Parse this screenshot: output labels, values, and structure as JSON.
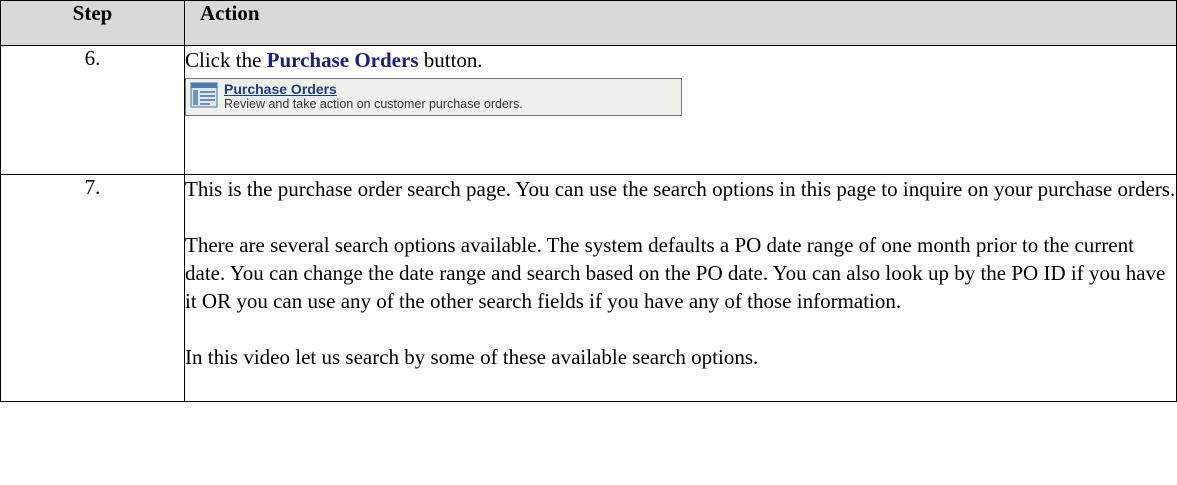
{
  "table": {
    "header": {
      "step": "Step",
      "action": "Action"
    },
    "rows": [
      {
        "step": "6.",
        "instruction_prefix": "Click the ",
        "instruction_bold": "Purchase Orders",
        "instruction_suffix": " button.",
        "button": {
          "icon": "document-list-icon",
          "title": "Purchase Orders",
          "description": "Review and take action on customer purchase orders."
        }
      },
      {
        "step": "7.",
        "paragraphs": [
          "This is the purchase order search page. You can use the search options in this page to inquire on your purchase orders.",
          "There are several search options available. The system defaults a PO date range of one month prior to the current date. You can change the date range and search based on the PO date. You can also look up by the PO ID if you have it OR you can use any of the other search fields if you have any of those information.",
          "In this video let us search by some of these available search options."
        ]
      }
    ]
  },
  "colors": {
    "header_bg": "#d9d9d9",
    "link_blue": "#1a1a8c",
    "button_bg": "#eef0ea"
  }
}
